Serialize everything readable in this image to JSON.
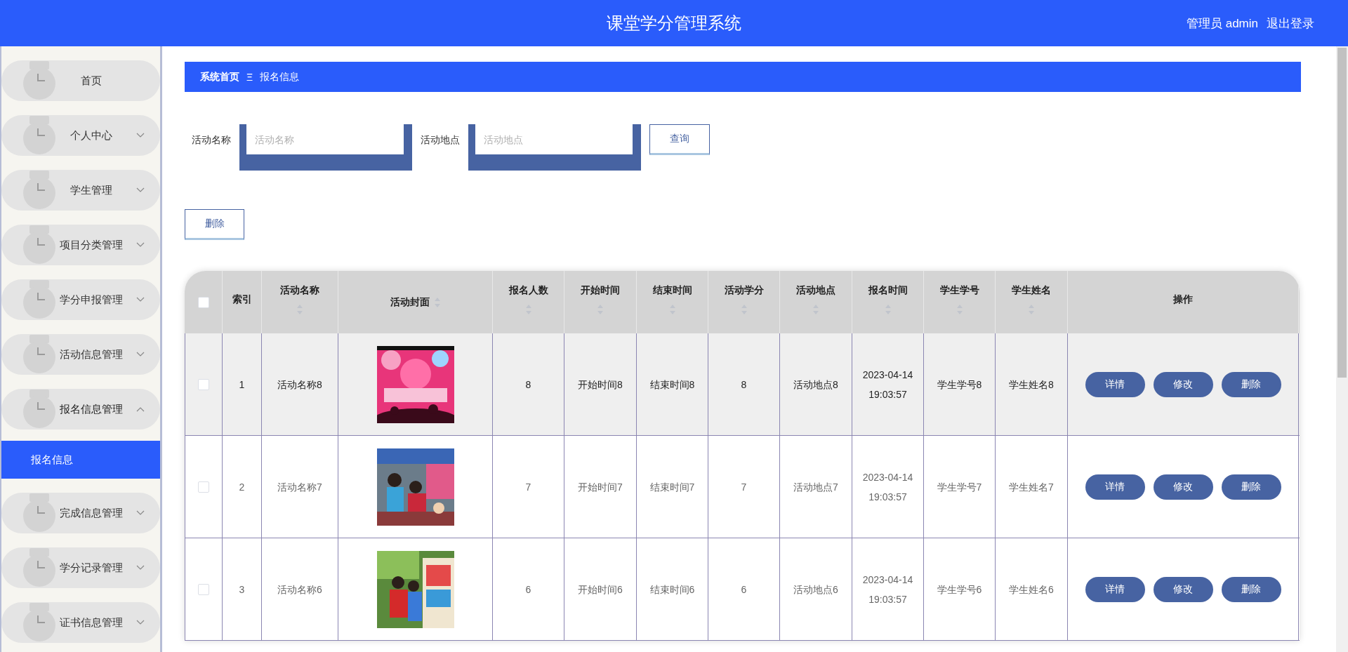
{
  "header": {
    "title": "课堂学分管理系统",
    "user": "管理员 admin",
    "logout": "退出登录"
  },
  "sidebar": {
    "items": [
      {
        "label": "首页"
      },
      {
        "label": "个人中心",
        "expanded": false
      },
      {
        "label": "学生管理",
        "expanded": false
      },
      {
        "label": "项目分类管理",
        "expanded": false
      },
      {
        "label": "学分申报管理",
        "expanded": false
      },
      {
        "label": "活动信息管理",
        "expanded": false
      },
      {
        "label": "报名信息管理",
        "expanded": true,
        "children": [
          {
            "label": "报名信息",
            "selected": true
          }
        ]
      },
      {
        "label": "完成信息管理",
        "expanded": false
      },
      {
        "label": "学分记录管理",
        "expanded": false
      },
      {
        "label": "证书信息管理",
        "expanded": false
      }
    ]
  },
  "breadcrumb": {
    "home": "系统首页",
    "separator": "Ξ",
    "current": "报名信息"
  },
  "search": {
    "fields": [
      {
        "label": "活动名称",
        "placeholder": "活动名称"
      },
      {
        "label": "活动地点",
        "placeholder": "活动地点"
      }
    ],
    "button": "查询"
  },
  "delete_button": "删除",
  "table": {
    "select_all": {
      "checked": false
    },
    "columns": [
      {
        "kind": "text",
        "label": "索引",
        "sortable": false
      },
      {
        "kind": "text",
        "label": "活动名称",
        "sortable": true
      },
      {
        "label": "活动封面",
        "sortable": true
      },
      {
        "kind": "text",
        "label": "报名人数",
        "sortable": true
      },
      {
        "kind": "text",
        "label": "开始时间",
        "sortable": true
      },
      {
        "kind": "text",
        "label": "结束时间",
        "sortable": true
      },
      {
        "kind": "text",
        "label": "活动学分",
        "sortable": true
      },
      {
        "kind": "text",
        "label": "活动地点",
        "sortable": true
      },
      {
        "kind": "text",
        "label": "报名时间",
        "sortable": true
      },
      {
        "kind": "text",
        "label": "学生学号",
        "sortable": true
      },
      {
        "kind": "text",
        "label": "学生姓名",
        "sortable": true
      },
      {
        "kind": "actions",
        "label": "操作",
        "sortable": false
      }
    ],
    "rows": [
      {
        "checked": false,
        "highlighted": true,
        "cells": [
          "1",
          "活动名称8",
          {
            "kind": "picture"
          },
          "8",
          "开始时间8",
          "结束时间8",
          "8",
          "活动地点8",
          "2023-04-14 19:03:57",
          "学生学号8",
          "学生姓名8",
          {
            "kind": "actions",
            "buttons": [
              "详情",
              "修改",
              "删除"
            ]
          }
        ]
      },
      {
        "checked": false,
        "highlighted": false,
        "cells": [
          "2",
          "活动名称7",
          {
            "kind": "picture"
          },
          "7",
          "开始时间7",
          "结束时间7",
          "7",
          "活动地点7",
          "2023-04-14 19:03:57",
          "学生学号7",
          "学生姓名7",
          {
            "kind": "actions",
            "buttons": [
              "详情",
              "修改",
              "删除"
            ]
          }
        ]
      },
      {
        "checked": false,
        "highlighted": false,
        "cells": [
          "3",
          "活动名称6",
          {
            "kind": "picture"
          },
          "6",
          "开始时间6",
          "结束时间6",
          "6",
          "活动地点6",
          "2023-04-14 19:03:57",
          "学生学号6",
          "学生姓名6",
          {
            "kind": "actions",
            "buttons": [
              "详情",
              "修改",
              "删除"
            ]
          }
        ]
      }
    ]
  }
}
